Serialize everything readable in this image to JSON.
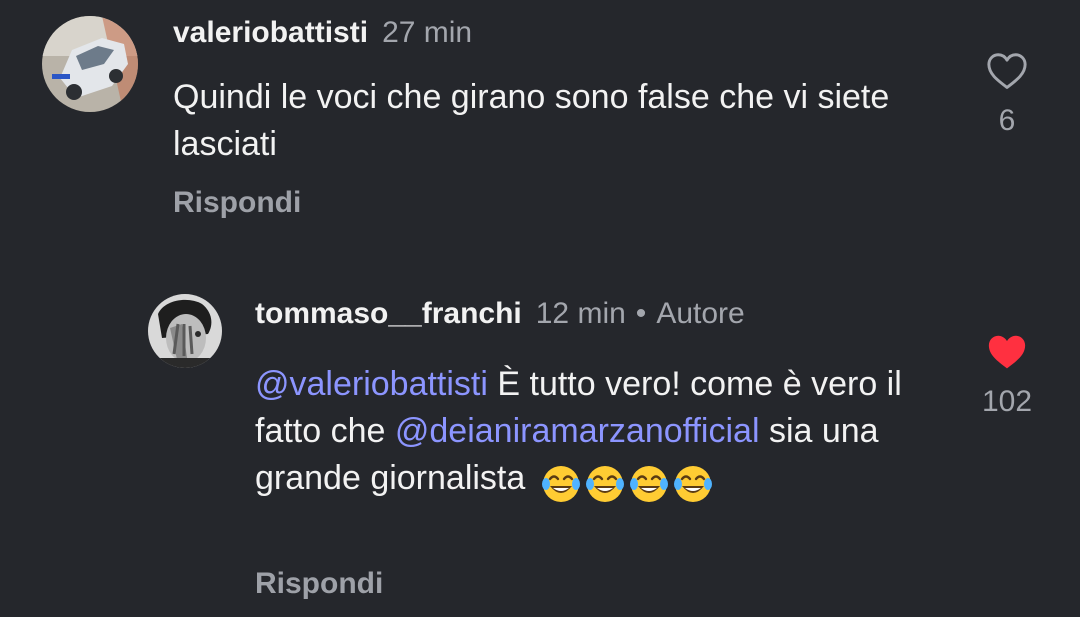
{
  "comments": [
    {
      "username": "valeriobattisti",
      "time": "27 min",
      "text": "Quindi le voci che girano sono false che vi siete lasciati",
      "reply_label": "Rispondi",
      "likes": "6",
      "liked": false,
      "avatar": "car-photo-avatar"
    },
    {
      "username": "tommaso__franchi",
      "time": "12 min",
      "separator": "•",
      "author_badge": "Autore",
      "mention1": "@valeriobattisti",
      "text_part1": " È tutto vero! come è vero il fatto che ",
      "mention2": "@deianiramarzanofficial",
      "text_part2": " sia una grande giornalista ",
      "emoji_name": "face-with-tears-of-joy",
      "emoji_count": 4,
      "reply_label": "Rispondi",
      "likes": "102",
      "liked": true,
      "avatar": "bw-portrait-avatar"
    }
  ],
  "colors": {
    "background": "#25272c",
    "mention": "#8c95ff",
    "like_active": "#ff3040",
    "secondary_text": "#a3a6ad"
  }
}
